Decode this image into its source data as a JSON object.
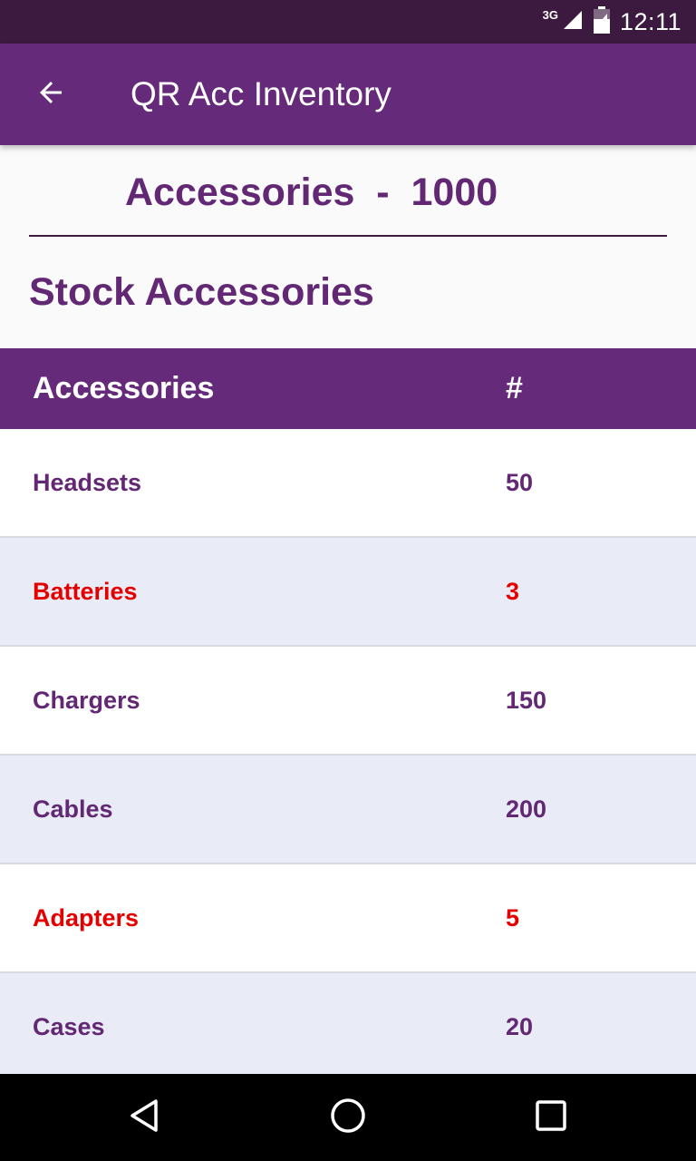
{
  "status_bar": {
    "network_type": "3G",
    "time": "12:11",
    "icons": [
      "signal-icon",
      "battery-icon"
    ]
  },
  "app_bar": {
    "back_icon": "arrow-back-icon",
    "title": "QR Acc Inventory"
  },
  "summary": {
    "text": "Accessories  -  1000"
  },
  "section": {
    "title": "Stock Accessories"
  },
  "table": {
    "headers": [
      "Accessories",
      "#"
    ],
    "rows": [
      {
        "name": "Headsets",
        "count": "50",
        "low_stock": false
      },
      {
        "name": "Batteries",
        "count": "3",
        "low_stock": true
      },
      {
        "name": "Chargers",
        "count": "150",
        "low_stock": false
      },
      {
        "name": "Cables",
        "count": "200",
        "low_stock": false
      },
      {
        "name": "Adapters",
        "count": "5",
        "low_stock": true
      },
      {
        "name": "Cases",
        "count": "20",
        "low_stock": false
      }
    ]
  },
  "nav_bar": {
    "icons": [
      "back-triangle-icon",
      "home-circle-icon",
      "recents-square-icon"
    ]
  },
  "colors": {
    "status_bar": "#3c1a40",
    "primary": "#662a7a",
    "text_primary": "#632874",
    "low_stock": "#e50000",
    "row_alt": "#e9ecf7",
    "row_plain": "#ffffff"
  }
}
